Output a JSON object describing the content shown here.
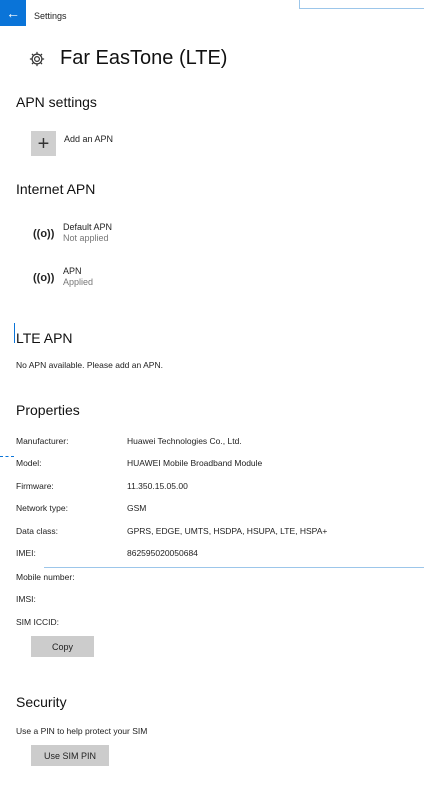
{
  "titlebar": {
    "back_icon": "back-arrow-icon",
    "app_title": "Settings"
  },
  "page": {
    "title": "Far EasTone (LTE)",
    "icon": "gear-icon"
  },
  "apn_settings": {
    "heading": "APN settings",
    "add_label": "Add an APN",
    "add_icon": "plus-icon"
  },
  "internet_apn": {
    "heading": "Internet APN",
    "items": [
      {
        "name": "Default APN",
        "status": "Not applied",
        "icon": "broadcast-icon"
      },
      {
        "name": "APN",
        "status": "Applied",
        "icon": "broadcast-icon"
      }
    ]
  },
  "lte_apn": {
    "heading": "LTE APN",
    "message": "No APN available. Please add an APN."
  },
  "properties": {
    "heading": "Properties",
    "rows": [
      {
        "key": "Manufacturer:",
        "value": "Huawei Technologies Co., Ltd."
      },
      {
        "key": "Model:",
        "value": "HUAWEI Mobile Broadband Module"
      },
      {
        "key": "Firmware:",
        "value": "11.350.15.05.00"
      },
      {
        "key": "Network type:",
        "value": "GSM"
      },
      {
        "key": "Data class:",
        "value": "GPRS, EDGE, UMTS, HSDPA, HSUPA, LTE, HSPA+"
      },
      {
        "key": "IMEI:",
        "value": "862595020050684"
      },
      {
        "key": "Mobile number:",
        "value": ""
      },
      {
        "key": "IMSI:",
        "value": ""
      },
      {
        "key": "SIM ICCID:",
        "value": ""
      }
    ],
    "copy_label": "Copy"
  },
  "security": {
    "heading": "Security",
    "message": "Use a PIN to help protect your SIM",
    "button_label": "Use SIM PIN"
  },
  "colors": {
    "accent": "#0a74d8",
    "button": "#cccccc",
    "secondary_text": "#777777"
  }
}
